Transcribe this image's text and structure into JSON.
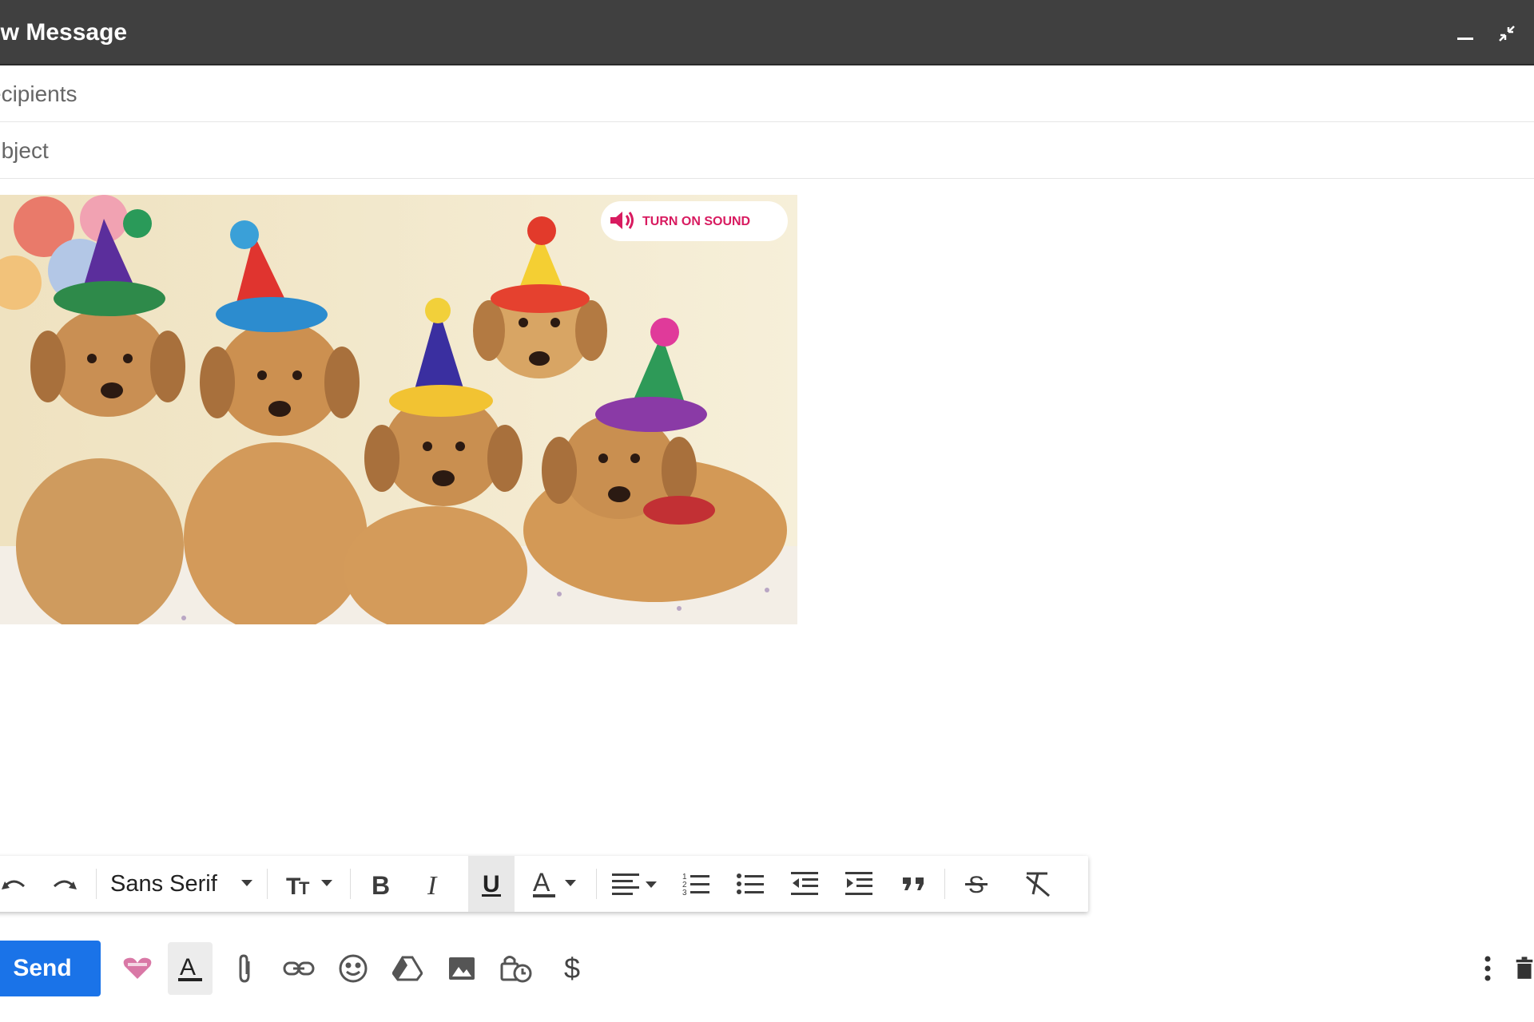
{
  "window": {
    "title": "ew Message"
  },
  "fields": {
    "recipients_placeholder": "ecipients",
    "subject_placeholder": "ubject"
  },
  "banner": {
    "sound_label": "TURN ON SOUND"
  },
  "toolbar": {
    "font_name": "Sans Serif"
  },
  "bottom_bar": {
    "send_label": "Send",
    "dollar_label": "$"
  },
  "colors": {
    "send_button": "#1a73e8",
    "title_bar": "#404040",
    "sound_accent": "#d81b60"
  }
}
